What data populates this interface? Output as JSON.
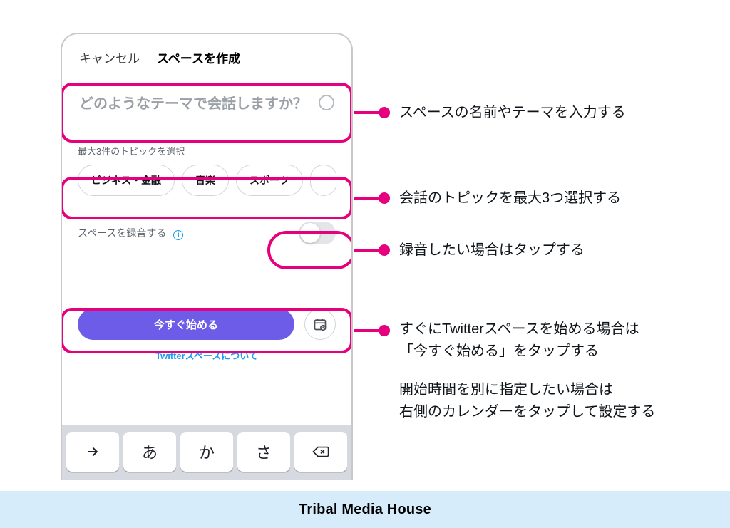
{
  "header": {
    "cancel": "キャンセル",
    "title": "スペースを作成"
  },
  "theme": {
    "placeholder": "どのようなテーマで会話しますか？"
  },
  "topics": {
    "label": "最大3件のトピックを選択",
    "items": [
      "ビジネス・金融",
      "音楽",
      "スポーツ"
    ]
  },
  "record": {
    "label": "スペースを録音する",
    "state": "off"
  },
  "start": {
    "button": "今すぐ始める",
    "about": "Twitterスペースについて"
  },
  "keyboard": {
    "keys": [
      "あ",
      "か",
      "さ"
    ]
  },
  "annotations": {
    "theme": "スペースの名前やテーマを入力する",
    "topics": "会話のトピックを最大3つ選択する",
    "record": "録音したい場合はタップする",
    "start_line1": "すぐにTwitterスペースを始める場合は",
    "start_line2": "「今すぐ始める」をタップする",
    "schedule_line1": "開始時間を別に指定したい場合は",
    "schedule_line2": "右側のカレンダーをタップして設定する"
  },
  "footer": {
    "brand": "Tribal Media House"
  },
  "colors": {
    "highlight": "#e6007e",
    "primary_button": "#6c5ce7",
    "link": "#1d9bf0",
    "footer_bg": "#d6ecfb"
  }
}
